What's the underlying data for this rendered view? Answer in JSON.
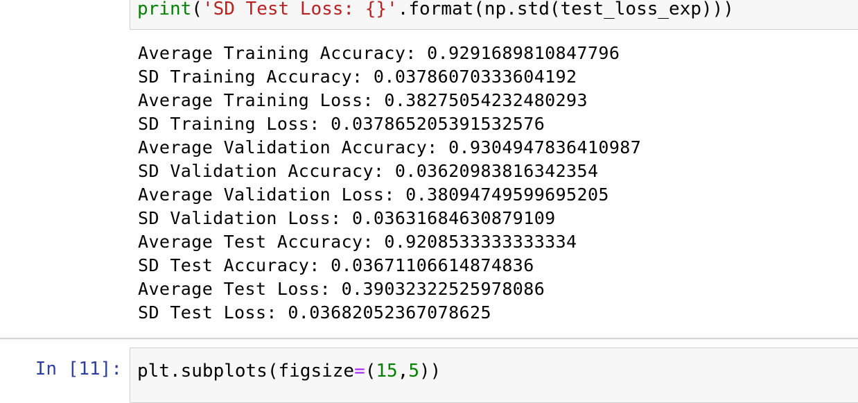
{
  "cells": {
    "previous": {
      "code": {
        "fn": "print",
        "open": "(",
        "string": "'SD Test Loss: {}'",
        "rest": ".format(np.std(test_loss_exp)))"
      },
      "output": [
        "Average Training Accuracy: 0.9291689810847796",
        "SD Training Accuracy: 0.03786070333604192",
        "Average Training Loss: 0.38275054232480293",
        "SD Training Loss: 0.037865205391532576",
        "Average Validation Accuracy: 0.9304947836410987",
        "SD Validation Accuracy: 0.03620983816342354",
        "Average Validation Loss: 0.38094749599695205",
        "SD Validation Loss: 0.03631684630879109",
        "Average Test Accuracy: 0.9208533333333334",
        "SD Test Accuracy: 0.03671106614874836",
        "Average Test Loss: 0.39032322525978086",
        "SD Test Loss: 0.03682052367078625"
      ]
    },
    "current": {
      "prompt": "In [11]:",
      "code": {
        "call": "plt.subplots(figsize",
        "eq": "=",
        "open": "(",
        "num1": "15",
        "comma": ",",
        "num2": "5",
        "close": "))"
      }
    }
  },
  "colors": {
    "prompt": "#303f9f",
    "builtin": "#008000",
    "string": "#ba2121",
    "operator": "#aa22ff",
    "cell_background": "#f7f7f7",
    "cell_border": "#cfcfcf"
  }
}
